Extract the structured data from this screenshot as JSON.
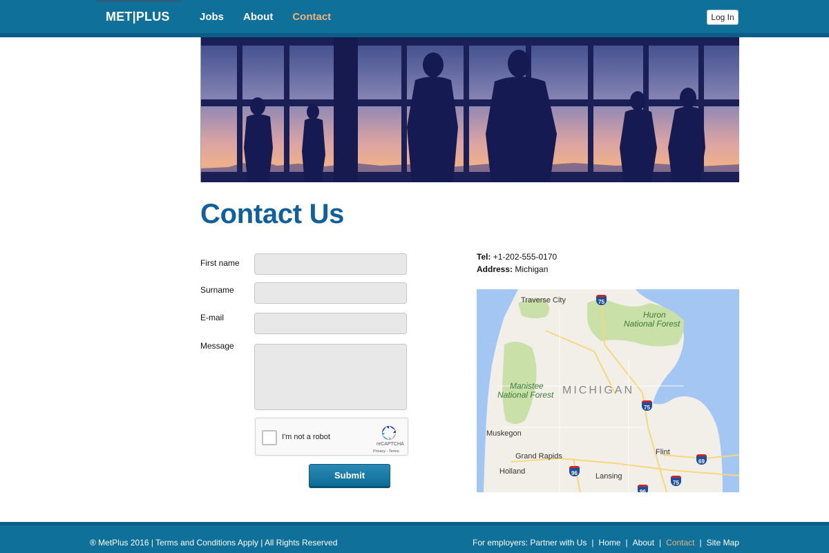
{
  "header": {
    "logo": "MET|PLUS",
    "nav": [
      {
        "label": "Jobs"
      },
      {
        "label": "About"
      },
      {
        "label": "Contact",
        "active": true
      }
    ],
    "login_label": "Log In"
  },
  "page": {
    "title": "Contact Us"
  },
  "form": {
    "first_name_label": "First name",
    "surname_label": "Surname",
    "email_label": "E-mail",
    "message_label": "Message",
    "first_name_value": "",
    "surname_value": "",
    "email_value": "",
    "message_value": "",
    "captcha_text": "I'm not a robot",
    "captcha_brand": "reCAPTCHA",
    "captcha_links": "Privacy - Terms",
    "submit_label": "Submit"
  },
  "contact": {
    "tel_label": "Tel:",
    "tel_value": "+1-202-555-0170",
    "address_label": "Address:",
    "address_value": "Michigan"
  },
  "map": {
    "state_label": "MICHIGAN",
    "cities": [
      "Traverse City",
      "Muskegon",
      "Grand Rapids",
      "Holland",
      "Lansing",
      "Flint"
    ],
    "forests": [
      "Huron\nNational Forest",
      "Manistee\nNational Forest"
    ],
    "highways": [
      "75",
      "75",
      "69",
      "96",
      "75",
      "96"
    ]
  },
  "footer": {
    "copyright": "® MetPlus 2016 | Terms and Conditions Apply | All Rights Reserved",
    "links": [
      {
        "label": "For employers: Partner with Us"
      },
      {
        "label": "Home"
      },
      {
        "label": "About"
      },
      {
        "label": "Contact",
        "active": true
      },
      {
        "label": "Site Map"
      }
    ]
  },
  "colors": {
    "header_bg": "#0f7099",
    "accent": "#e9b57a",
    "title": "#10609c"
  }
}
